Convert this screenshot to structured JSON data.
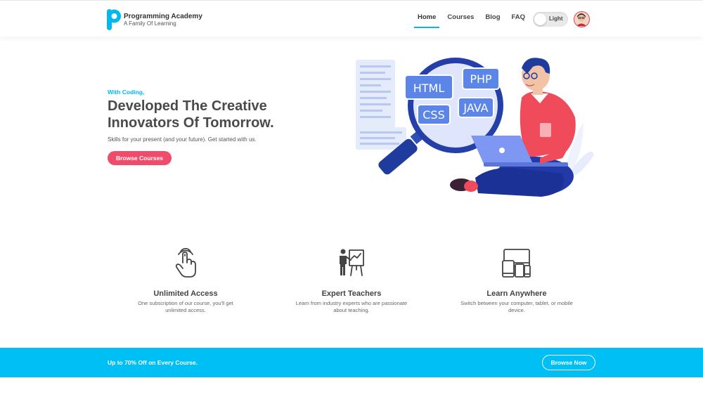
{
  "header": {
    "brand_title": "Programming Academy",
    "brand_subtitle": "A Family Of Learning",
    "nav": [
      {
        "label": "Home",
        "active": true
      },
      {
        "label": "Courses",
        "active": false
      },
      {
        "label": "Blog",
        "active": false
      },
      {
        "label": "FAQ",
        "active": false
      }
    ],
    "theme_toggle_label": "Light",
    "avatar_icon": "user-avatar"
  },
  "hero": {
    "tagline": "With Coding,",
    "title": "Developed The Creative Innovators Of Tomorrow.",
    "subtitle": "Skills for your present (and your future). Get started with us.",
    "cta_label": "Browse Courses",
    "illustration_tags": [
      "HTML",
      "PHP",
      "CSS",
      "JAVA"
    ]
  },
  "features": [
    {
      "icon": "touch-hand-icon",
      "title": "Unlimited Access",
      "desc": "One subscription of our course, you'll get unlimited access."
    },
    {
      "icon": "teacher-board-icon",
      "title": "Expert Teachers",
      "desc": "Learn from industry experts who are passionate about teaching."
    },
    {
      "icon": "devices-icon",
      "title": "Learn Anywhere",
      "desc": "Switch between your computer, tablet, or mobile device."
    }
  ],
  "banner": {
    "text": "Up to 70% Off on Every Course.",
    "button_label": "Browse Now"
  },
  "colors": {
    "accent": "#00b8f0",
    "cta": "#f04b6b",
    "banner": "#00bff5",
    "heading": "#4a4a4a"
  }
}
